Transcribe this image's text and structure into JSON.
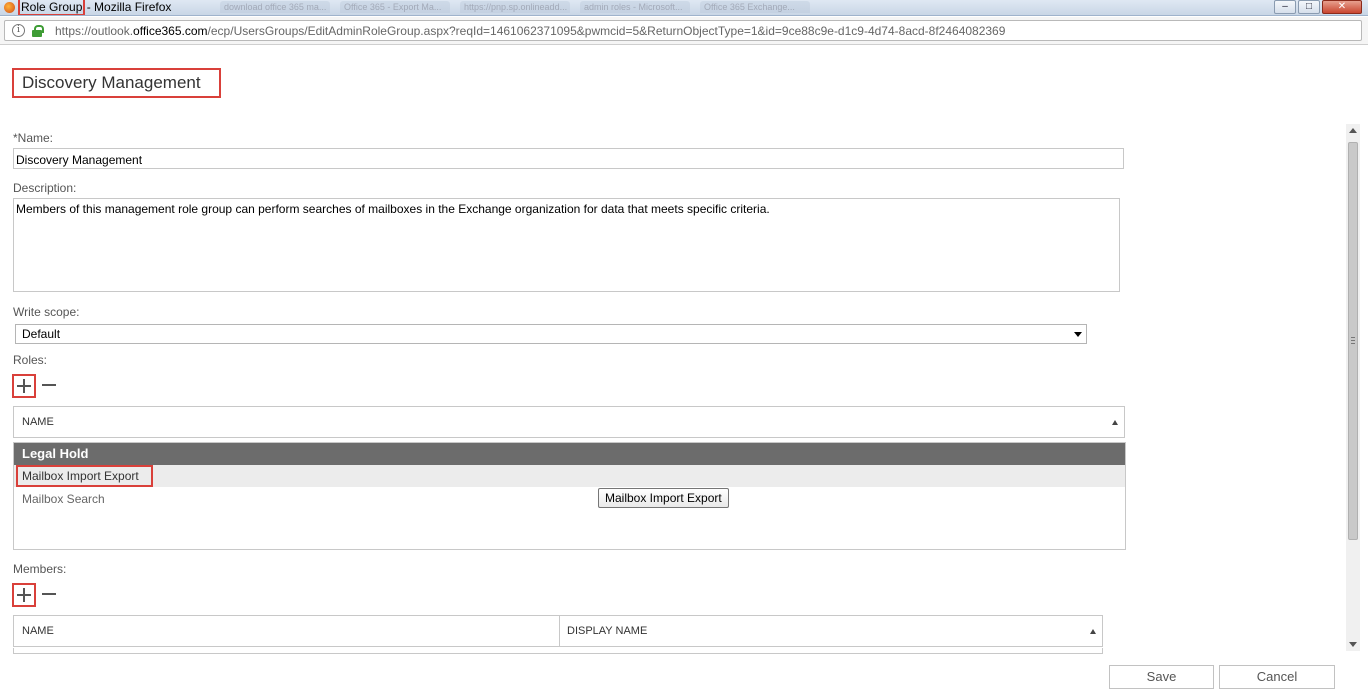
{
  "window": {
    "title_highlight": "Role Group",
    "title_rest": " - Mozilla Firefox",
    "ghost_tabs": [
      "download office 365 ma...",
      "Office 365 - Export Ma...",
      "https://pnp.sp.onlineadd...",
      "admin roles - Microsoft...",
      "Office 365 Exchange..."
    ],
    "min_icon": "minimize-icon",
    "max_icon": "maximize-icon",
    "close_icon": "close-icon"
  },
  "urlbar": {
    "url_prefix": "https://outlook.",
    "url_domain": "office365.com",
    "url_suffix": "/ecp/UsersGroups/EditAdminRoleGroup.aspx?reqId=1461062371095&pwmcid=5&ReturnObjectType=1&id=9ce88c9e-d1c9-4d74-8acd-8f2464082369"
  },
  "page": {
    "title": "Discovery Management"
  },
  "form": {
    "name_label": "*Name:",
    "name_value": "Discovery Management",
    "description_label": "Description:",
    "description_value": "Members of this management role group can perform searches of mailboxes in the Exchange organization for data that meets specific criteria.",
    "write_scope_label": "Write scope:",
    "write_scope_value": "Default",
    "roles_label": "Roles:",
    "members_label": "Members:"
  },
  "roles_table": {
    "header": "NAME",
    "rows": [
      "Legal Hold",
      "Mailbox Import Export",
      "Mailbox Search"
    ],
    "tooltip": "Mailbox Import Export"
  },
  "members_table": {
    "headers": [
      "NAME",
      "DISPLAY NAME"
    ]
  },
  "footer": {
    "save": "Save",
    "cancel": "Cancel"
  },
  "colors": {
    "highlight_red": "#d9403a",
    "selected_row": "#6c6c6c"
  }
}
